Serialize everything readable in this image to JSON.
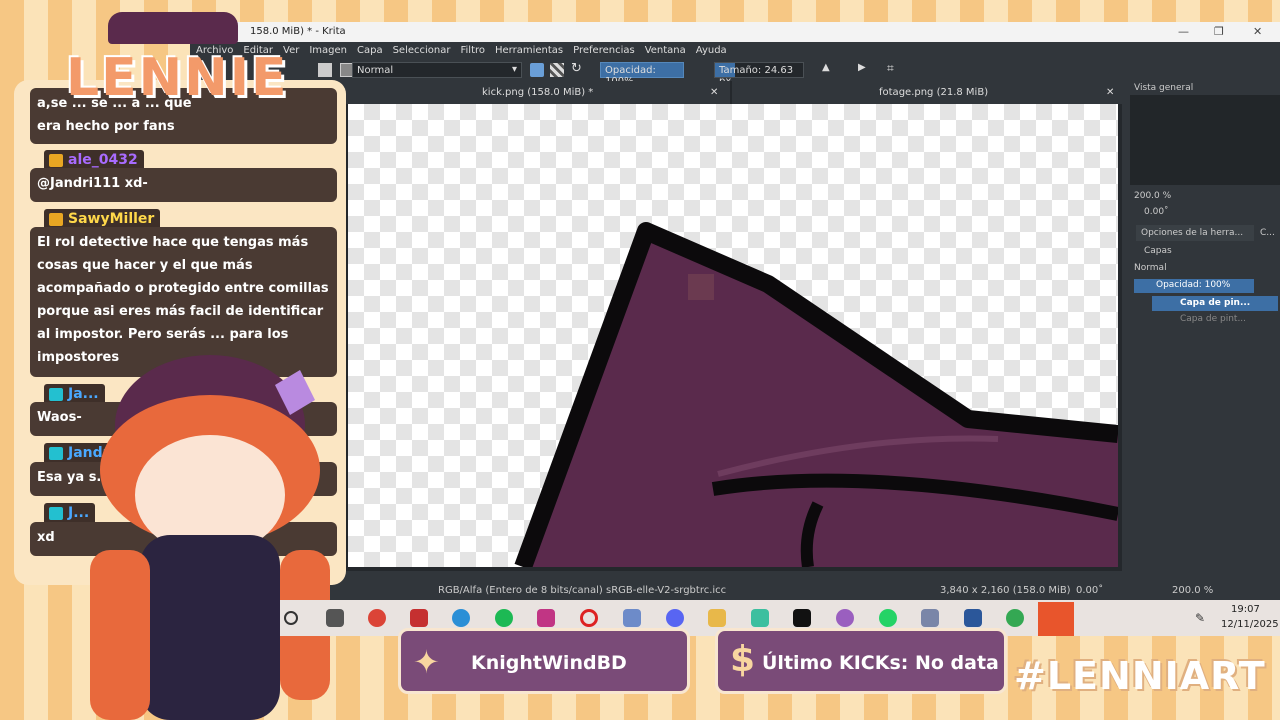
{
  "window": {
    "title": "kick.png (158.0 MiB) * - Krita",
    "title_visible": "158.0 MiB) * - Krita",
    "min_icon": "minimize-icon",
    "max_icon": "maximize-icon",
    "close_icon": "close-icon"
  },
  "menu": [
    "Archivo",
    "Editar",
    "Ver",
    "Imagen",
    "Capa",
    "Seleccionar",
    "Filtro",
    "Herramientas",
    "Preferencias",
    "Ventana",
    "Ayuda"
  ],
  "toolbar": {
    "blend_mode": "Normal",
    "opacity": "Opacidad: 100%",
    "size": "Tamaño: 24.63 px"
  },
  "tabs": [
    {
      "label": "kick.png (158.0 MiB) *"
    },
    {
      "label": "fotage.png (21.8 MiB)"
    }
  ],
  "status": {
    "color_space": "RGB/Alfa (Entero de 8 bits/canal)  sRGB-elle-V2-srgbtrc.icc",
    "dimensions": "3,840 x 2,160 (158.0 MiB)",
    "rotation": "0.00˚",
    "zoom": "200.0 %"
  },
  "dockers": {
    "overview_title": "Vista general",
    "overview_zoom": "200.0 %",
    "overview_angle": "0.00˚",
    "tool_options_tab": "Opciones de la herra...",
    "tool_options_tab2": "C...",
    "layers_title": "Capas",
    "layer_blend": "Normal",
    "layer_opacity": "Opacidad: 100%",
    "layers": [
      {
        "name": "Capa de pin...",
        "selected": true
      },
      {
        "name": "Capa de pint...",
        "selected": false
      }
    ]
  },
  "chat": {
    "top_partial": "a,se ... se ... a ... que",
    "top_partial_2": "era hecho por fans",
    "messages": [
      {
        "user": "ale_0432",
        "text": "@Jandri111 xd-"
      },
      {
        "user": "SawyMiller",
        "text": "El rol detective hace que tengas más cosas que hacer y el que más acompañado o protegido entre comillas porque asi eres más facil de identificar al impostor. Pero serás ... para los impostores"
      },
      {
        "user": "Ja...",
        "text": "Waos-"
      },
      {
        "user": "Jandri...",
        "text": "Esa ya s..."
      },
      {
        "user": "J...",
        "text": "xd"
      }
    ]
  },
  "logo_text": "LENNIE",
  "taskbar": {
    "time": "19:07",
    "date": "12/11/2025",
    "icons": [
      "circle-icon",
      "task-view-icon",
      "chrome-icon",
      "vivaldi-icon",
      "edge-icon",
      "spotify-icon",
      "instagram-icon",
      "opera-icon",
      "app-icon",
      "discord-icon",
      "folder-icon",
      "app2-icon",
      "capcut-icon",
      "krita-icon",
      "whatsapp-icon",
      "avatar-icon",
      "word-icon",
      "chrome-dev-icon",
      "capcut2-icon"
    ]
  },
  "banners": {
    "follower": "KnightWindBD",
    "kicks": "Último KICKs: No data",
    "hashtag": "#LENNIART"
  },
  "colors": {
    "krita_bg": "#31363b",
    "chat_bubble": "#4a3a33",
    "banner": "#7a4b78",
    "username_purple": "#a86bff",
    "username_yellow": "#ffd84a",
    "username_blue": "#4aa8ff"
  }
}
